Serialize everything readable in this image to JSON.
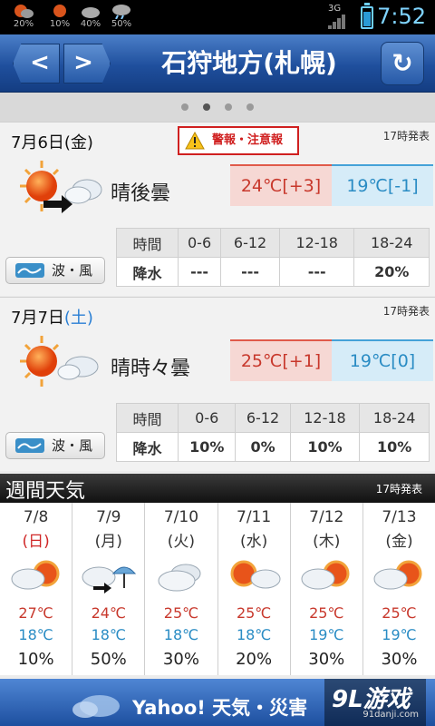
{
  "statusbar": {
    "notifications": [
      {
        "icon": "sun-cloud-icon",
        "label": "20%"
      },
      {
        "icon": "sun-icon",
        "label": "10%"
      },
      {
        "icon": "cloud-icon",
        "label": "40%"
      },
      {
        "icon": "rain-icon",
        "label": "50%"
      }
    ],
    "network": "3G",
    "time": "7:52"
  },
  "header": {
    "title": "石狩地方(札幌)",
    "prev_symbol": "<",
    "next_symbol": ">",
    "refresh_symbol": "↻"
  },
  "pager": {
    "count": 4,
    "active": 1
  },
  "days": [
    {
      "date": "7月6日",
      "weekday": "(金)",
      "weekday_color": "normal",
      "warning": "警報・注意報",
      "issued": "17時発表",
      "weather_icon": "sun-then-cloud-icon",
      "weather": "晴後曇",
      "high": "24℃[+3]",
      "low": "19℃[-1]",
      "wave_label": "波・風",
      "rain_header": [
        "時間",
        "0-6",
        "6-12",
        "12-18",
        "18-24"
      ],
      "rain_values": [
        "降水",
        "---",
        "---",
        "---",
        "20%"
      ]
    },
    {
      "date": "7月7日",
      "weekday": "(土)",
      "weekday_color": "saturday",
      "issued": "17時発表",
      "weather_icon": "sun-sometimes-cloud-icon",
      "weather": "晴時々曇",
      "high": "25℃[+1]",
      "low": "19℃[0]",
      "wave_label": "波・風",
      "rain_header": [
        "時間",
        "0-6",
        "6-12",
        "12-18",
        "18-24"
      ],
      "rain_values": [
        "降水",
        "10%",
        "0%",
        "10%",
        "10%"
      ]
    }
  ],
  "weekly": {
    "title": "週間天気",
    "issued": "17時発表",
    "days": [
      {
        "date": "7/8",
        "weekday": "(日)",
        "icon": "cloud-sun-icon",
        "high": "27℃",
        "low": "18℃",
        "pop": "10%"
      },
      {
        "date": "7/9",
        "weekday": "(月)",
        "icon": "cloud-then-rain-icon",
        "high": "24℃",
        "low": "18℃",
        "pop": "50%"
      },
      {
        "date": "7/10",
        "weekday": "(火)",
        "icon": "cloud-icon",
        "high": "25℃",
        "low": "18℃",
        "pop": "30%"
      },
      {
        "date": "7/11",
        "weekday": "(水)",
        "icon": "sun-cloud-icon",
        "high": "25℃",
        "low": "18℃",
        "pop": "20%"
      },
      {
        "date": "7/12",
        "weekday": "(木)",
        "icon": "cloud-sun-icon",
        "high": "25℃",
        "low": "19℃",
        "pop": "30%"
      },
      {
        "date": "7/13",
        "weekday": "(金)",
        "icon": "cloud-sun-icon",
        "high": "25℃",
        "low": "19℃",
        "pop": "30%"
      }
    ]
  },
  "footer": {
    "text": "Yahoo! 天気・災害"
  },
  "watermark": {
    "logo": "9L游戏",
    "site": "91danji.com"
  }
}
